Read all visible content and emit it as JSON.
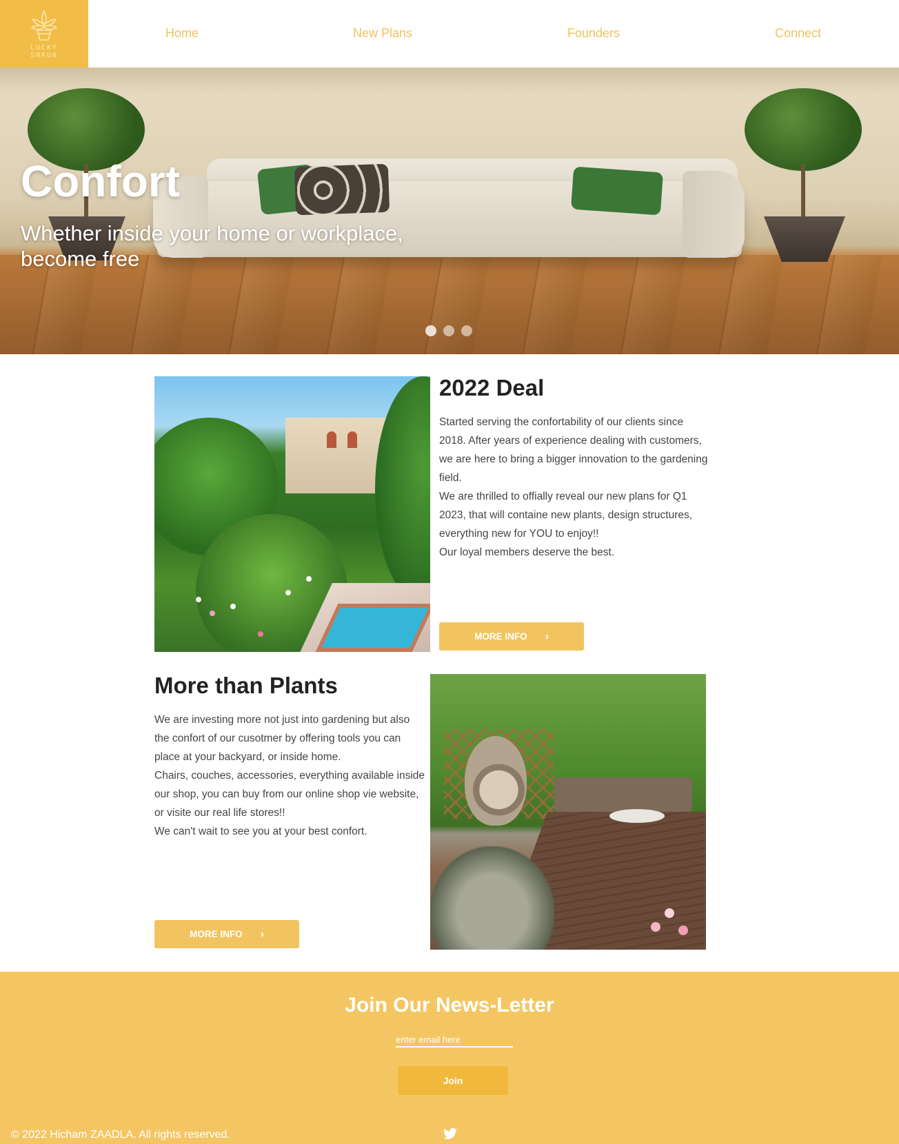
{
  "brand": {
    "logo_line1": "LUCKY",
    "logo_line2": "SHRUB",
    "accent_color": "#f1bd46"
  },
  "nav": {
    "items": [
      {
        "label": "Home"
      },
      {
        "label": "New Plans"
      },
      {
        "label": "Founders"
      },
      {
        "label": "Connect"
      }
    ]
  },
  "hero": {
    "title": "Confort",
    "subtitle": "Whether inside your home or workplace, become free",
    "slides": 3,
    "active_slide": 1
  },
  "section1": {
    "title": "2022 Deal",
    "paragraphs": [
      "Started serving the confortability of our clients since 2018. After years of experience dealing with customers, we are here to bring a bigger innovation to the gardening field.",
      "We are thrilled to offially reveal our new plans for Q1 2023, that will containe new plants, design structures, everything new for YOU to enjoy!!",
      "Our loyal members deserve the best."
    ],
    "button_label": "MORE INFO",
    "image_icon": "garden-photo"
  },
  "section2": {
    "title": "More than Plants",
    "paragraphs": [
      "We are investing more not just into gardening but also the confort of our cusotmer by offering tools you can place at your backyard, or inside home.",
      "Chairs, couches, accessories, everything available inside our shop, you can buy from our online shop vie website, or visite our real life stores!!",
      "We can't wait to see you at your best confort."
    ],
    "button_label": "MORE INFO",
    "image_icon": "patio-photo"
  },
  "newsletter": {
    "title": "Join Our News-Letter",
    "email_placeholder": "enter email here",
    "email_value": "",
    "join_label": "Join"
  },
  "footer": {
    "copyright": "© 2022 Hicham ZAADLA. All rights reserved.",
    "social_icon": "twitter-icon"
  }
}
